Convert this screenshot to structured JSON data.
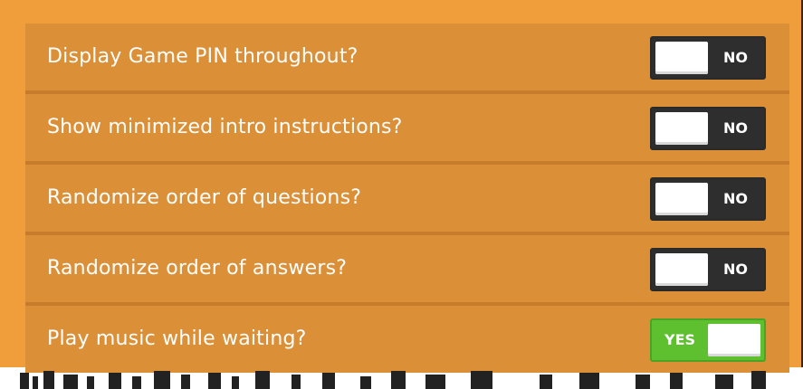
{
  "settings": [
    {
      "label": "Display Game PIN throughout?",
      "state": "NO",
      "on": false
    },
    {
      "label": "Show minimized intro instructions?",
      "state": "NO",
      "on": false
    },
    {
      "label": "Randomize order of questions?",
      "state": "NO",
      "on": false
    },
    {
      "label": "Randomize order of answers?",
      "state": "NO",
      "on": false
    },
    {
      "label": "Play music while waiting?",
      "state": "YES",
      "on": true
    }
  ],
  "colors": {
    "frame": "#f09d3c",
    "row": "#db8f37",
    "toggle_off": "#2e2e2e",
    "toggle_on": "#5ebf2f"
  }
}
